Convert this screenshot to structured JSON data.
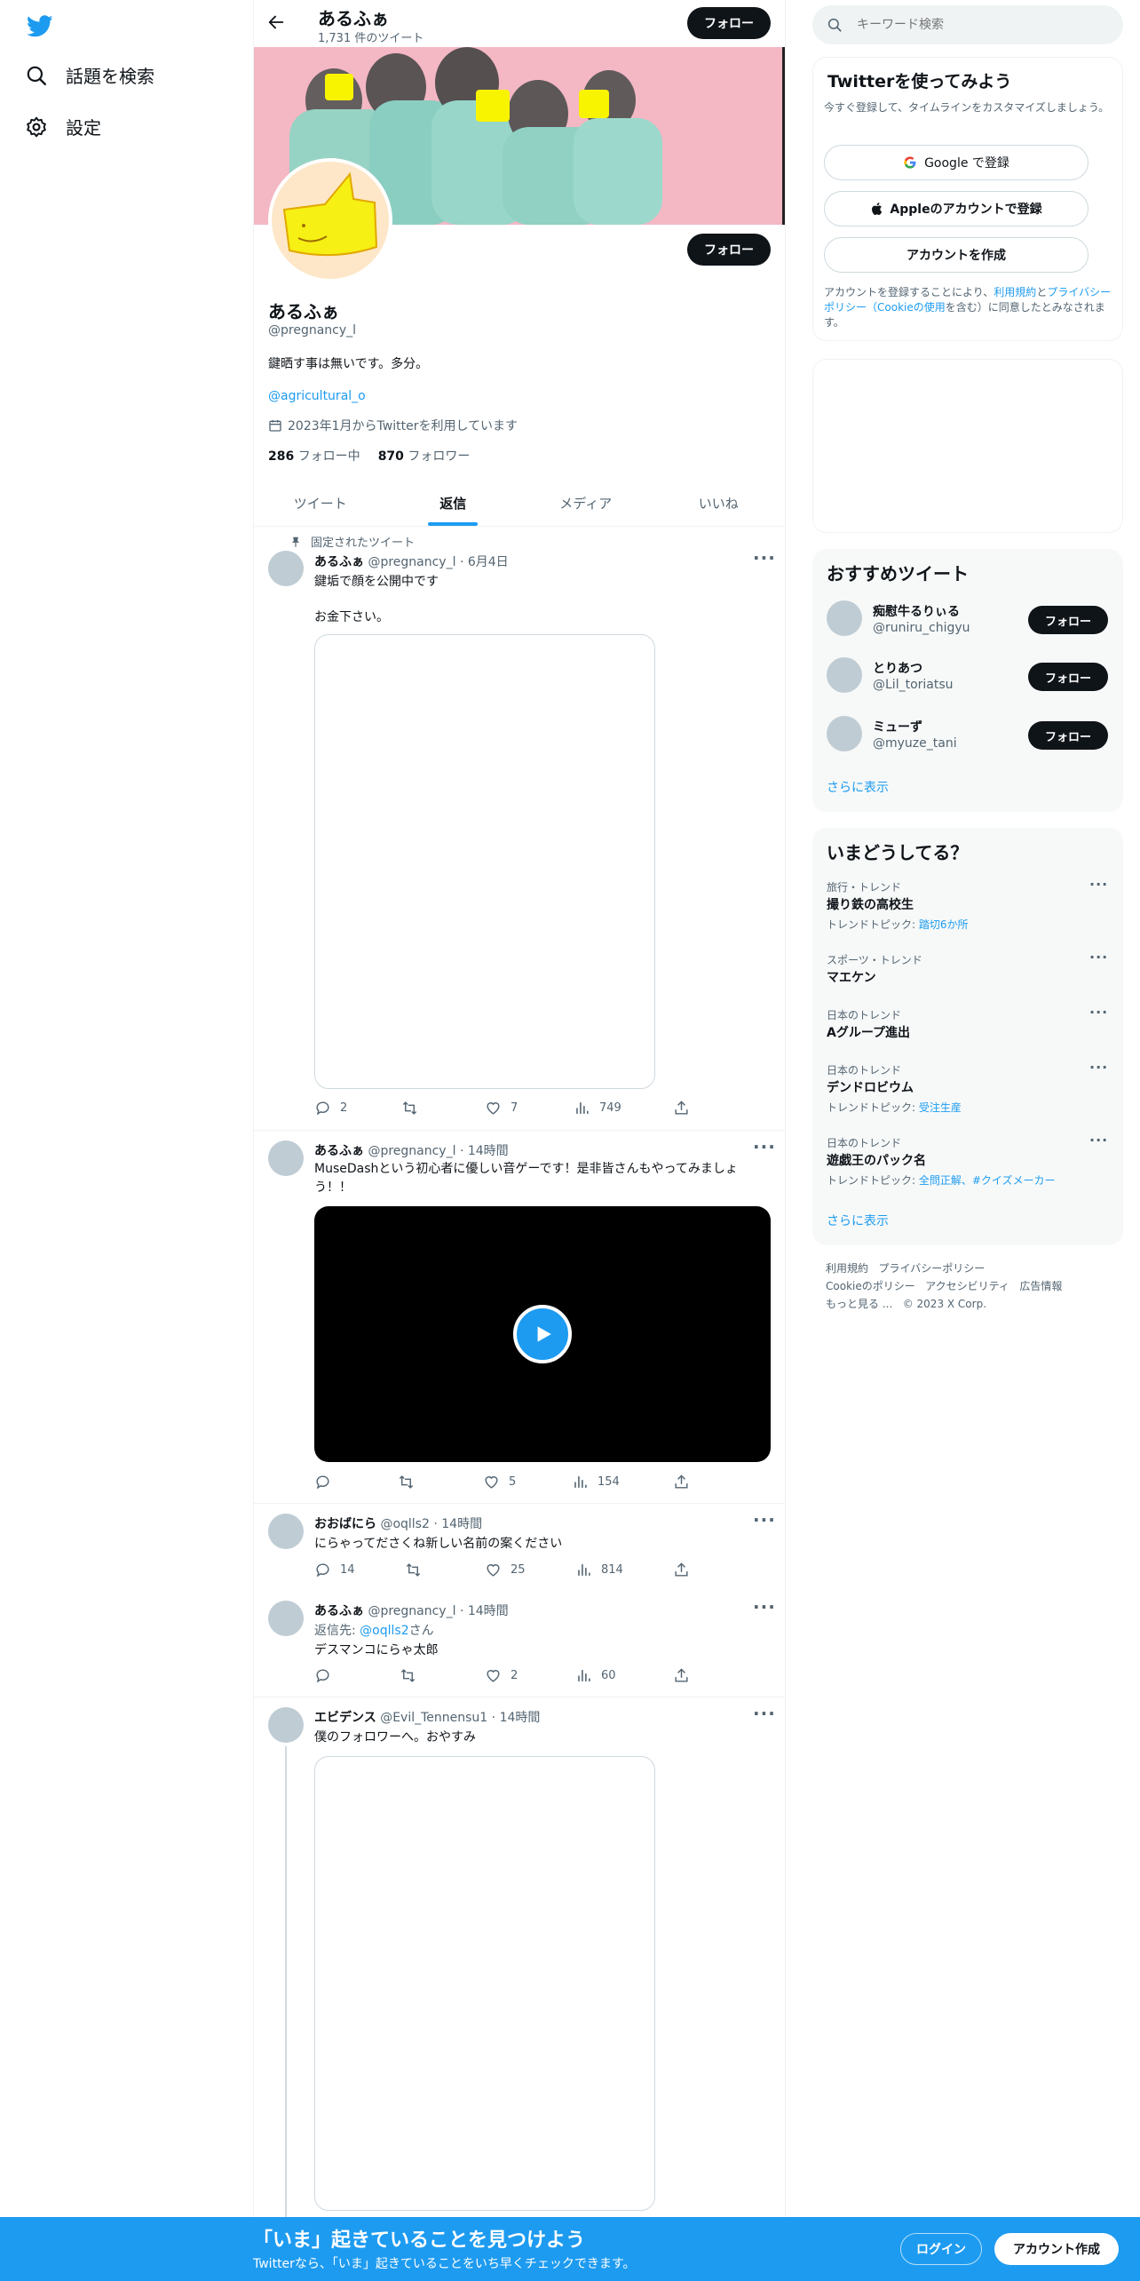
{
  "colors": {
    "accent": "#1d9bf0",
    "dark": "#0f1419",
    "muted": "#536471",
    "banner": "#f4b7c4",
    "bottom_bar": "#1d9bf0"
  },
  "left_nav": {
    "logo": "twitter-bird-icon",
    "items": [
      {
        "label": "話題を検索",
        "icon": "search-icon"
      },
      {
        "label": "設定",
        "icon": "gear-icon"
      }
    ]
  },
  "header": {
    "name": "あるふぁ",
    "tweet_count": "1,731 件のツイート",
    "follow_label": "フォロー"
  },
  "profile": {
    "follow_label": "フォロー",
    "name": "あるふぁ",
    "handle": "@pregnancy_l",
    "bio": "鍵晒す事は無いです。多分。",
    "link": "@agricultural_o",
    "joined": "2023年1月からTwitterを利用しています",
    "following_count": "286",
    "following_label": "フォロー中",
    "followers_count": "870",
    "followers_label": "フォロワー"
  },
  "tabs": [
    "ツイート",
    "返信",
    "メディア",
    "いいね"
  ],
  "active_tab": "返信",
  "tweets": [
    {
      "pinned_label": "固定されたツイート",
      "name": "あるふぁ",
      "handle": "@pregnancy_l",
      "time": "6月4日",
      "text1": "鍵垢で顔を公開中です",
      "text2": "お金下さい。",
      "replies": "2",
      "retweets": "",
      "likes": "7",
      "views": "749"
    },
    {
      "name": "あるふぁ",
      "handle": "@pregnancy_l",
      "time": "14時間",
      "text": "MuseDashという初心者に優しい音ゲーです！是非皆さんもやってみましょう！！",
      "replies": "",
      "retweets": "",
      "likes": "5",
      "views": "154"
    },
    {
      "name": "おおばにら",
      "handle": "@oqlls2",
      "time": "14時間",
      "text": "にらゃってださくね新しい名前の案ください",
      "replies": "14",
      "retweets": "",
      "likes": "25",
      "views": "814"
    },
    {
      "name": "あるふぁ",
      "handle": "@pregnancy_l",
      "time": "14時間",
      "reply_to_prefix": "返信先: ",
      "reply_to": "@oqlls2",
      "reply_to_suffix": "さん",
      "text": "デスマンコにらゃ太郎",
      "replies": "",
      "retweets": "",
      "likes": "2",
      "views": "60"
    },
    {
      "name": "エビデンス",
      "handle": "@Evil_Tennensu1",
      "time": "14時間",
      "text": "僕のフォロワーへ。おやすみ"
    }
  ],
  "search": {
    "placeholder": "キーワード検索"
  },
  "signup": {
    "title": "Twitterを使ってみよう",
    "subtitle": "今すぐ登録して、タイムラインをカスタマイズしましょう。",
    "google_label": "Google で登録",
    "apple_label": "Appleのアカウントで登録",
    "create_label": "アカウントを作成",
    "legal_pre": "アカウントを登録することにより、",
    "legal_terms": "利用規約",
    "legal_and": "と",
    "legal_privacy": "プライバシーポリシー（Cookieの使用",
    "legal_post": "を含む）に同意したとみなされます。"
  },
  "recommend": {
    "title": "おすすめツイート",
    "follow_label": "フォロー",
    "more": "さらに表示",
    "users": [
      {
        "name": "痴慰牛るりぃる",
        "handle": "@runiru_chigyu"
      },
      {
        "name": "とりあつ",
        "handle": "@Lil_toriatsu"
      },
      {
        "name": "ミューず",
        "handle": "@myuze_tani"
      }
    ]
  },
  "trends": {
    "title": "いまどうしてる？",
    "more": "さらに表示",
    "items": [
      {
        "meta": "旅行・トレンド",
        "name": "撮り鉄の高校生",
        "topic_label": "トレンドトピック: ",
        "topic": "踏切6か所"
      },
      {
        "meta": "スポーツ・トレンド",
        "name": "マエケン"
      },
      {
        "meta": "日本のトレンド",
        "name": "Aグループ進出"
      },
      {
        "meta": "日本のトレンド",
        "name": "デンドロビウム",
        "topic_label": "トレンドトピック: ",
        "topic": "受注生産"
      },
      {
        "meta": "日本のトレンド",
        "name": "遊戯王のパック名",
        "topic_label": "トレンドトピック: ",
        "topic": "全問正解、#クイズメーカー"
      }
    ]
  },
  "footer": {
    "links": [
      "利用規約",
      "プライバシーポリシー",
      "Cookieのポリシー",
      "アクセシビリティ",
      "広告情報",
      "もっと見る ..."
    ],
    "copyright": "© 2023 X Corp."
  },
  "bottom_bar": {
    "title": "「いま」起きていることを見つけよう",
    "subtitle": "Twitterなら、「いま」起きていることをいち早くチェックできます。",
    "login_label": "ログイン",
    "signup_label": "アカウント作成"
  }
}
